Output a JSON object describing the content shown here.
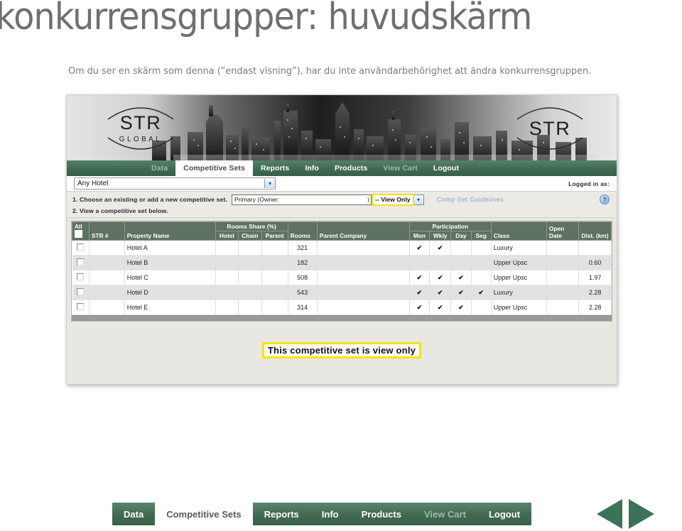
{
  "slide": {
    "title": "konkurrensgrupper: huvudskärm",
    "subtitle": "Om du ser en skärm som denna (”endast visning”), har du inte användarbehörighet att ändra konkurrensgruppen."
  },
  "brand": {
    "logo_left_main": "STR",
    "logo_left_sub": "GLOBAL",
    "logo_left_dot": ".",
    "logo_right_main": "STR",
    "logo_right_dot": "."
  },
  "nav": {
    "tabs": [
      {
        "label": "Data",
        "state": "dim"
      },
      {
        "label": "Competitive Sets",
        "state": "active"
      },
      {
        "label": "Reports",
        "state": "normal"
      },
      {
        "label": "Info",
        "state": "normal"
      },
      {
        "label": "Products",
        "state": "normal"
      },
      {
        "label": "View Cart",
        "state": "dim"
      },
      {
        "label": "Logout",
        "state": "normal"
      }
    ]
  },
  "toolbar": {
    "hotel_select_value": "Any Hotel",
    "hotel_select_arrow": "▾",
    "logged_in_as": "Logged in as:"
  },
  "instructions": {
    "step1": "1. Choose an existing or add a new competitive set.",
    "step2": "2. View a competitive set below.",
    "compset_value": "Primary (Owner:",
    "compset_value_end": ")",
    "view_only_label": "-- View Only",
    "view_only_arrow": "▾",
    "guidelines_link": "Comp Set Guidelines",
    "help_icon_glyph": "?"
  },
  "table": {
    "group_headers": {
      "rooms_share": "Rooms Share (%)",
      "participation": "Participation"
    },
    "columns": {
      "all": "All",
      "str_number": "STR #",
      "property_name": "Property Name",
      "hotel": "Hotel",
      "chain": "Chain",
      "parent": "Parent",
      "rooms": "Rooms",
      "parent_company": "Parent Company",
      "mon": "Mon",
      "wkly": "Wkly",
      "day": "Day",
      "seg": "Seg",
      "class": "Class",
      "open_date": "Open Date",
      "dist_km": "Dist. (km)"
    },
    "check_glyph": "✔",
    "rows": [
      {
        "str_number": "",
        "property_name": "Hotel A",
        "hotel": "",
        "chain": "",
        "parent": "",
        "rooms": "321",
        "parent_company": "",
        "mon": "✔",
        "wkly": "✔",
        "day": "",
        "seg": "",
        "class": "Luxury",
        "open_date": "",
        "dist_km": ""
      },
      {
        "str_number": "",
        "property_name": "Hotel B",
        "hotel": "",
        "chain": "",
        "parent": "",
        "rooms": "182",
        "parent_company": "",
        "mon": "",
        "wkly": "",
        "day": "",
        "seg": "",
        "class": "Upper Upsc",
        "open_date": "",
        "dist_km": "0.60"
      },
      {
        "str_number": "",
        "property_name": "Hotel C",
        "hotel": "",
        "chain": "",
        "parent": "",
        "rooms": "508",
        "parent_company": "",
        "mon": "✔",
        "wkly": "✔",
        "day": "✔",
        "seg": "",
        "class": "Upper Upsc",
        "open_date": "",
        "dist_km": "1.97"
      },
      {
        "str_number": "",
        "property_name": "Hotel D",
        "hotel": "",
        "chain": "",
        "parent": "",
        "rooms": "543",
        "parent_company": "",
        "mon": "✔",
        "wkly": "✔",
        "day": "✔",
        "seg": "✔",
        "class": "Luxury",
        "open_date": "",
        "dist_km": "2.28"
      },
      {
        "str_number": "",
        "property_name": "Hotel E",
        "hotel": "",
        "chain": "",
        "parent": "",
        "rooms": "314",
        "parent_company": "",
        "mon": "✔",
        "wkly": "✔",
        "day": "✔",
        "seg": "",
        "class": "Upper Upsc",
        "open_date": "",
        "dist_km": "2.28"
      }
    ]
  },
  "notice": {
    "view_only_message": "This competitive set is view only"
  },
  "bottom_nav": {
    "tabs": [
      {
        "label": "Data",
        "state": "normal"
      },
      {
        "label": "Competitive Sets",
        "state": "active"
      },
      {
        "label": "Reports",
        "state": "normal"
      },
      {
        "label": "Info",
        "state": "normal"
      },
      {
        "label": "Products",
        "state": "normal"
      },
      {
        "label": "View Cart",
        "state": "dim"
      },
      {
        "label": "Logout",
        "state": "normal"
      }
    ],
    "prev_arrow": "prev-arrow",
    "next_arrow": "next-arrow"
  },
  "colors": {
    "brand_green": "#3f6a52",
    "header_green": "#5f7161",
    "highlight_yellow": "#f5e400",
    "link_blue": "#8da2bd",
    "title_grey": "#6f6f6f"
  }
}
